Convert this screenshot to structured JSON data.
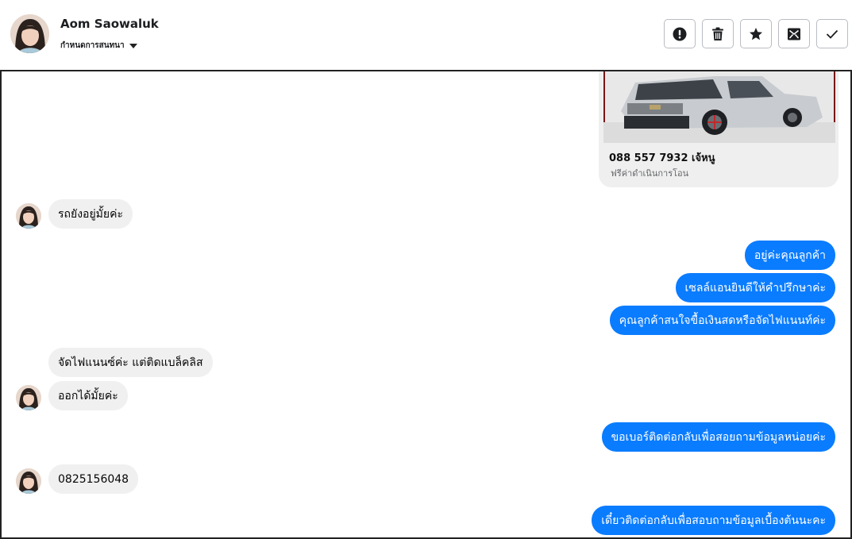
{
  "header": {
    "contact_name": "Aom Saowaluk",
    "conversation_settings": "กำหนดการสนทนา",
    "actions": [
      "spam-icon",
      "trash-icon",
      "star-icon",
      "mark-unread-icon",
      "check-icon"
    ]
  },
  "card": {
    "title": "088 557 7932 เจ้หนู",
    "subtitle": "ฟรีค่าดำเนินการโอน"
  },
  "messages": [
    {
      "from": "contact",
      "text": "รถยังอยู่มั้ยค่ะ"
    },
    {
      "from": "page",
      "text": "อยู่ค่ะคุณลูกค้า"
    },
    {
      "from": "page",
      "text": "เซลล์แอนยินดีให้คำปรึกษาค่ะ"
    },
    {
      "from": "page",
      "text": "คุณลูกค้าสนใจขื้อเงินสดหรือจัดไฟแนนท์ค่ะ"
    },
    {
      "from": "contact",
      "text": "จัดไฟแนนซ์ค่ะ แต่ติดแบล็คลิส"
    },
    {
      "from": "contact",
      "text": "ออกได้มั้ยค่ะ"
    },
    {
      "from": "page",
      "text": "ขอเบอร์ติดต่อกลับเพื่อสอยถามข้อมูลหน่อยค่ะ"
    },
    {
      "from": "contact",
      "text": "0825156048"
    },
    {
      "from": "page",
      "text": "เดี๋ยวติดต่อกลับเพื่อสอบถามข้อมูลเบื้องต้นนะคะ"
    }
  ],
  "colors": {
    "outgoing_bubble": "#0a7cff",
    "incoming_bubble": "#f0f0f0"
  }
}
